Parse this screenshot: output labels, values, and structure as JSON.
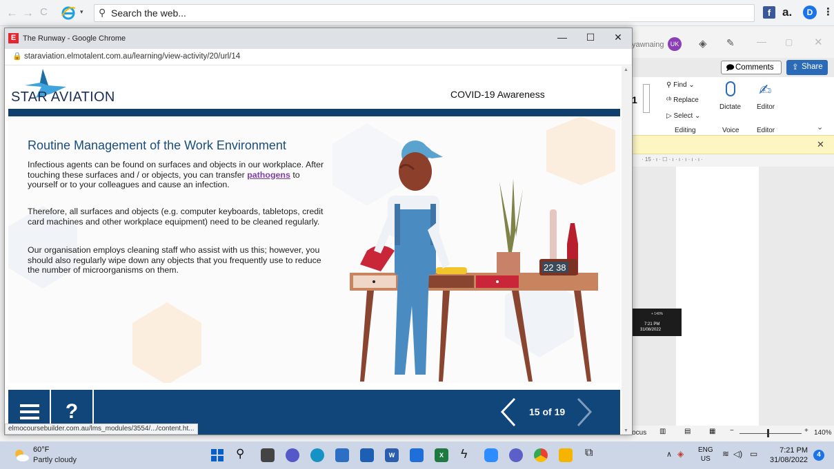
{
  "browser": {
    "search_placeholder": "Search the web...",
    "back_icon": "←",
    "forward_icon": "→",
    "reload_icon": "C"
  },
  "word": {
    "username": "yawnaing",
    "avatar_initials": "UK",
    "comments_label": "Comments",
    "share_label": "Share",
    "find_label": "Find",
    "replace_label": "Replace",
    "select_label": "Select",
    "editing_group": "Editing",
    "dictate_label": "Dictate",
    "voice_group": "Voice",
    "editor_label": "Editor",
    "editor_group": "Editor",
    "font_size_fragment": "1",
    "ruler_text": "· 15 · ı · ☐ · ı · ı · ı · ı · ı ·",
    "focus_label": "Focus",
    "zoom_label": "140%",
    "thumb_time": "7:21 PM",
    "thumb_date": "31/08/2022",
    "thumb_zoom": "+ 140%"
  },
  "popup": {
    "title": "The Runway - Google Chrome",
    "url": "staraviation.elmotalent.com.au/learning/view-activity/20/url/14",
    "status_link": "elmocoursebuilder.com.au/lms_modules/3554/.../content.ht..."
  },
  "course": {
    "brand": "STAR AVIATION",
    "module_title": "COVID-19 Awareness",
    "heading": "Routine Management of the Work Environment",
    "para1_before": "Infectious agents can be found on surfaces and objects in our workplace. After touching these surfaces and / or objects, you can transfer ",
    "para1_link": "pathogens",
    "para1_after": " to yourself or to your colleagues and cause an infection.",
    "para2": "Therefore, all surfaces and objects (e.g. computer keyboards, tabletops, credit card machines and other workplace equipment) need to be cleaned regularly.",
    "para3": "Our organisation employs cleaning staff who assist with us this; however, you should also regularly wipe down any objects that you frequently use to reduce the number of microorganisms on them.",
    "clock_display": "22 38",
    "help_label": "?",
    "page_counter": "15 of 19",
    "colors": {
      "header_blue": "#103f6e",
      "footer_blue": "#10467a",
      "heading_blue": "#1a4d7c",
      "link_purple": "#7d3fa6"
    }
  },
  "taskbar": {
    "temperature": "60°F",
    "weather": "Partly cloudy",
    "lang": "ENG",
    "region": "US",
    "time": "7:21 PM",
    "date": "31/08/2022",
    "notifications": "4"
  }
}
